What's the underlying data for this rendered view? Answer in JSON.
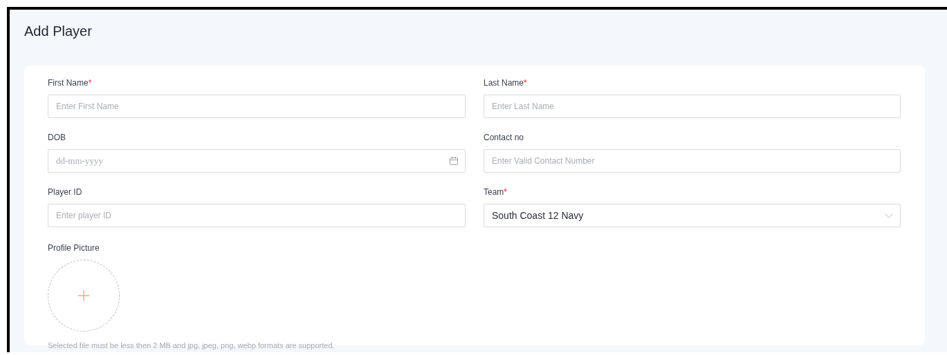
{
  "page": {
    "title": "Add Player"
  },
  "fields": [
    {
      "kind": "text",
      "label": "First Name",
      "required_mark": "*",
      "placeholder": "Enter First Name"
    },
    {
      "kind": "text",
      "label": "Last Name",
      "required_mark": "*",
      "placeholder": "Enter Last Name"
    },
    {
      "kind": "date",
      "label": "DOB",
      "placeholder": "dd-mm-yyyy"
    },
    {
      "kind": "text",
      "label": "Contact no",
      "placeholder": "Enter Valid Contact Number"
    },
    {
      "kind": "text",
      "label": "Player ID",
      "placeholder": "Enter player ID"
    },
    {
      "kind": "select",
      "label": "Team",
      "required_mark": "*",
      "value": "South Coast 12 Navy"
    }
  ],
  "profile_picture": {
    "label": "Profile Picture",
    "hint": "Selected file must be less then 2 MB and jpg, jpeg, png, webp formats are supported."
  }
}
